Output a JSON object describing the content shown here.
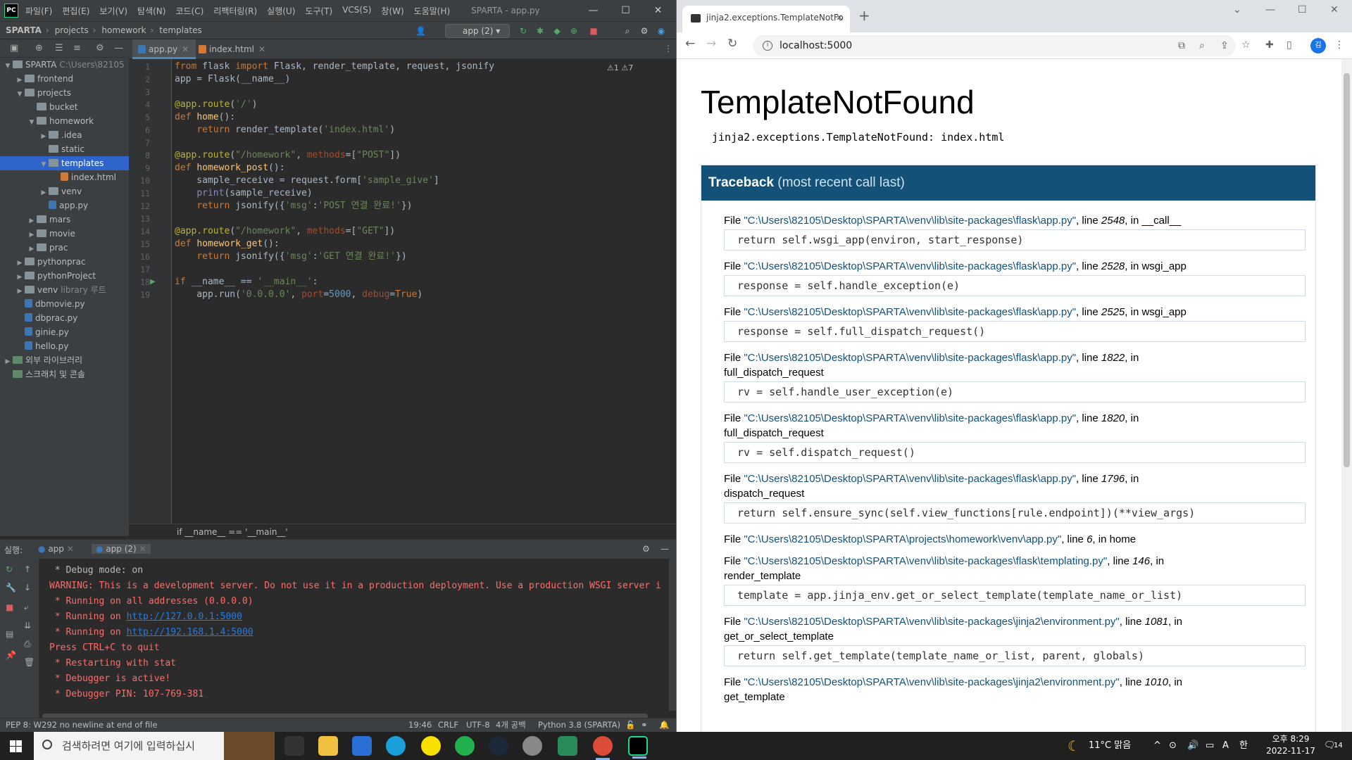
{
  "ide": {
    "menu": [
      "파일(F)",
      "편집(E)",
      "보기(V)",
      "탐색(N)",
      "코드(C)",
      "리팩터링(R)",
      "실행(U)",
      "도구(T)",
      "VCS(S)",
      "창(W)",
      "도움말(H)"
    ],
    "window_title": "SPARTA - app.py",
    "breadcrumb": [
      "SPARTA",
      "projects",
      "homework",
      "templates"
    ],
    "run_config": "app (2)",
    "project_tree": [
      {
        "label": "SPARTA",
        "hint": "C:\\Users\\82105",
        "depth": 0,
        "arrow": "v",
        "icon": "fold"
      },
      {
        "label": "frontend",
        "depth": 1,
        "arrow": ">",
        "icon": "fold"
      },
      {
        "label": "projects",
        "depth": 1,
        "arrow": "v",
        "icon": "fold"
      },
      {
        "label": "bucket",
        "depth": 2,
        "arrow": "",
        "icon": "fold"
      },
      {
        "label": "homework",
        "depth": 2,
        "arrow": "v",
        "icon": "fold"
      },
      {
        "label": ".idea",
        "depth": 3,
        "arrow": ">",
        "icon": "fold"
      },
      {
        "label": "static",
        "depth": 3,
        "arrow": "",
        "icon": "fold"
      },
      {
        "label": "templates",
        "depth": 3,
        "arrow": "v",
        "icon": "fold",
        "selected": true
      },
      {
        "label": "index.html",
        "depth": 4,
        "arrow": "",
        "icon": "html"
      },
      {
        "label": "venv",
        "depth": 3,
        "arrow": ">",
        "icon": "fold"
      },
      {
        "label": "app.py",
        "depth": 3,
        "arrow": "",
        "icon": "py"
      },
      {
        "label": "mars",
        "depth": 2,
        "arrow": ">",
        "icon": "fold"
      },
      {
        "label": "movie",
        "depth": 2,
        "arrow": ">",
        "icon": "fold"
      },
      {
        "label": "prac",
        "depth": 2,
        "arrow": ">",
        "icon": "fold"
      },
      {
        "label": "pythonprac",
        "depth": 1,
        "arrow": ">",
        "icon": "fold"
      },
      {
        "label": "pythonProject",
        "depth": 1,
        "arrow": ">",
        "icon": "fold"
      },
      {
        "label": "venv",
        "hint": "library 루트",
        "depth": 1,
        "arrow": ">",
        "icon": "fold"
      },
      {
        "label": "dbmovie.py",
        "depth": 1,
        "arrow": "",
        "icon": "py"
      },
      {
        "label": "dbprac.py",
        "depth": 1,
        "arrow": "",
        "icon": "py"
      },
      {
        "label": "ginie.py",
        "depth": 1,
        "arrow": "",
        "icon": "py"
      },
      {
        "label": "hello.py",
        "depth": 1,
        "arrow": "",
        "icon": "py"
      },
      {
        "label": "외부 라이브러리",
        "depth": 0,
        "arrow": ">",
        "icon": "lib"
      },
      {
        "label": "스크래치 및 콘솔",
        "depth": 0,
        "arrow": "",
        "icon": "lib"
      }
    ],
    "tabs": [
      {
        "label": "app.py",
        "active": true
      },
      {
        "label": "index.html",
        "active": false
      }
    ],
    "inspections": "⚠1  ⚠7",
    "code_lines": [
      "from flask import Flask, render_template, request, jsonify",
      "app = Flask(__name__)",
      "",
      "@app.route('/')",
      "def home():",
      "    return render_template('index.html')",
      "",
      "@app.route(\"/homework\", methods=[\"POST\"])",
      "def homework_post():",
      "    sample_receive = request.form['sample_give']",
      "    print(sample_receive)",
      "    return jsonify({'msg':'POST 연결 완료!'})",
      "",
      "@app.route(\"/homework\", methods=[\"GET\"])",
      "def homework_get():",
      "    return jsonify({'msg':'GET 연결 완료!'})",
      "",
      "if __name__ == '__main__':",
      "    app.run('0.0.0.0', port=5000, debug=True)"
    ],
    "code_breadcrumb": "if __name__ == '__main__'",
    "run_label": "실행:",
    "run_tabs": [
      "app",
      "app (2)"
    ],
    "console": [
      {
        "text": " * Debug mode: on",
        "cls": ""
      },
      {
        "text": "WARNING: This is a development server. Do not use it in a production deployment. Use a production WSGI server i",
        "cls": "red"
      },
      {
        "text": " * Running on all addresses (0.0.0.0)",
        "cls": "red"
      },
      {
        "text": " * Running on ",
        "link": "http://127.0.0.1:5000",
        "cls": "red"
      },
      {
        "text": " * Running on ",
        "link": "http://192.168.1.4:5000",
        "cls": "red"
      },
      {
        "text": "Press CTRL+C to quit",
        "cls": "red"
      },
      {
        "text": " * Restarting with stat",
        "cls": "red"
      },
      {
        "text": " * Debugger is active!",
        "cls": "red"
      },
      {
        "text": " * Debugger PIN: 107-769-381",
        "cls": "red"
      }
    ],
    "status": {
      "message": "PEP 8: W292 no newline at end of file",
      "position": "19:46",
      "line_sep": "CRLF",
      "encoding": "UTF-8",
      "indent": "4개 공백",
      "interpreter": "Python 3.8 (SPARTA)"
    }
  },
  "browser": {
    "tab_title": "jinja2.exceptions.TemplateNotFo",
    "url": "localhost:5000",
    "avatar": "김",
    "page": {
      "heading": "TemplateNotFound",
      "message": "jinja2.exceptions.TemplateNotFound: index.html",
      "traceback_title": "Traceback",
      "traceback_sub": "(most recent call last)",
      "frames": [
        {
          "file": "\"C:\\Users\\82105\\Desktop\\SPARTA\\venv\\lib\\site-packages\\flask\\app.py\"",
          "line": "2548",
          "func": "__call__",
          "code": "return self.wsgi_app(environ, start_response)"
        },
        {
          "file": "\"C:\\Users\\82105\\Desktop\\SPARTA\\venv\\lib\\site-packages\\flask\\app.py\"",
          "line": "2528",
          "func": "wsgi_app",
          "code": "response = self.handle_exception(e)"
        },
        {
          "file": "\"C:\\Users\\82105\\Desktop\\SPARTA\\venv\\lib\\site-packages\\flask\\app.py\"",
          "line": "2525",
          "func": "wsgi_app",
          "code": "response = self.full_dispatch_request()"
        },
        {
          "file": "\"C:\\Users\\82105\\Desktop\\SPARTA\\venv\\lib\\site-packages\\flask\\app.py\"",
          "line": "1822",
          "func": "full_dispatch_request",
          "code": "rv = self.handle_user_exception(e)",
          "wrap": true
        },
        {
          "file": "\"C:\\Users\\82105\\Desktop\\SPARTA\\venv\\lib\\site-packages\\flask\\app.py\"",
          "line": "1820",
          "func": "full_dispatch_request",
          "code": "rv = self.dispatch_request()",
          "wrap": true
        },
        {
          "file": "\"C:\\Users\\82105\\Desktop\\SPARTA\\venv\\lib\\site-packages\\flask\\app.py\"",
          "line": "1796",
          "func": "dispatch_request",
          "code": "return self.ensure_sync(self.view_functions[rule.endpoint])(**view_args)",
          "wrap": true
        },
        {
          "file": "\"C:\\Users\\82105\\Desktop\\SPARTA\\projects\\homework\\venv\\app.py\"",
          "line": "6",
          "func": "home",
          "code": ""
        },
        {
          "file": "\"C:\\Users\\82105\\Desktop\\SPARTA\\venv\\lib\\site-packages\\flask\\templating.py\"",
          "line": "146",
          "func": "render_template",
          "code": "template = app.jinja_env.get_or_select_template(template_name_or_list)",
          "wrap": true
        },
        {
          "file": "\"C:\\Users\\82105\\Desktop\\SPARTA\\venv\\lib\\site-packages\\jinja2\\environment.py\"",
          "line": "1081",
          "func": "get_or_select_template",
          "code": "return self.get_template(template_name_or_list, parent, globals)",
          "wrap": true
        },
        {
          "file": "\"C:\\Users\\82105\\Desktop\\SPARTA\\venv\\lib\\site-packages\\jinja2\\environment.py\"",
          "line": "1010",
          "func": "get_template",
          "code": "",
          "wrap": true
        }
      ]
    }
  },
  "taskbar": {
    "search_placeholder": "검색하려면 여기에 입력하십시",
    "weather": "11°C 맑음",
    "ime": "A",
    "lang": "한",
    "time": "오후 8:29",
    "date": "2022-11-17",
    "notifications": "14"
  }
}
